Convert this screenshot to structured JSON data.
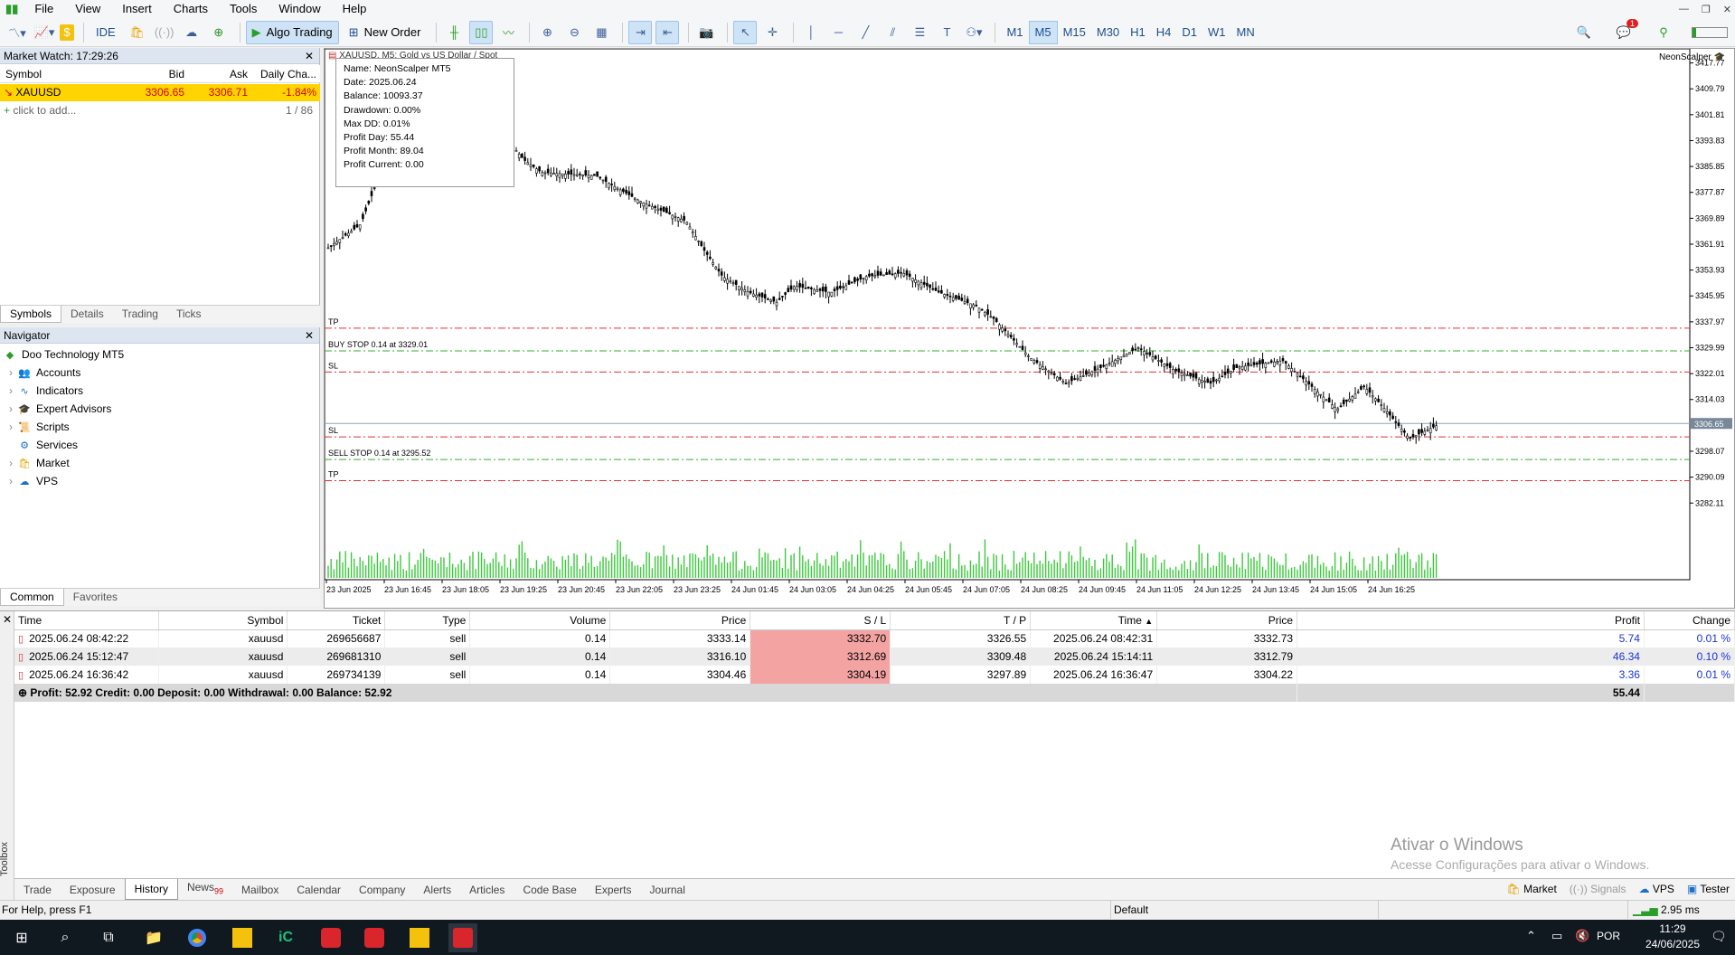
{
  "menu": [
    "File",
    "View",
    "Insert",
    "Charts",
    "Tools",
    "Window",
    "Help"
  ],
  "toolbar": {
    "ide": "IDE",
    "algo": "Algo Trading",
    "new_order": "New Order",
    "timeframes": [
      "M1",
      "M5",
      "M15",
      "M30",
      "H1",
      "H4",
      "D1",
      "W1",
      "MN"
    ],
    "active_tf": "M5",
    "notif_count": "1"
  },
  "market_watch": {
    "title": "Market Watch: 17:29:26",
    "columns": [
      "Symbol",
      "Bid",
      "Ask",
      "Daily Cha..."
    ],
    "rows": [
      {
        "symbol": "XAUUSD",
        "bid": "3306.65",
        "ask": "3306.71",
        "change": "-1.84%"
      }
    ],
    "add": "click to add...",
    "count": "1 / 86",
    "tabs": [
      "Symbols",
      "Details",
      "Trading",
      "Ticks"
    ]
  },
  "navigator": {
    "title": "Navigator",
    "root": "Doo Technology MT5",
    "items": [
      "Accounts",
      "Indicators",
      "Expert Advisors",
      "Scripts",
      "Services",
      "Market",
      "VPS"
    ],
    "tabs": [
      "Common",
      "Favorites"
    ]
  },
  "chart": {
    "title": "XAUUSD, M5: Gold vs US Dollar / Spot",
    "ea_name": "NeonScalper",
    "info": {
      "name": "Name: NeonScalper MT5",
      "date": "Date: 2025.06.24",
      "balance": "Balance: 10093.37",
      "drawdown": "Drawdown: 0.00%",
      "maxdd": "Max DD: 0.01%",
      "pday": "Profit Day: 55.44",
      "pmonth": "Profit Month: 89.04",
      "pcur": "Profit Current: 0.00"
    },
    "price_labels": [
      "3417.77",
      "3409.79",
      "3401.81",
      "3393.83",
      "3385.85",
      "3377.87",
      "3369.89",
      "3361.91",
      "3353.93",
      "3345.95",
      "3337.97",
      "3329.99",
      "3322.01",
      "3314.03",
      "3306.65",
      "3298.07",
      "3290.09",
      "3282.11"
    ],
    "time_labels": [
      "23 Jun 2025",
      "23 Jun 16:45",
      "23 Jun 18:05",
      "23 Jun 19:25",
      "23 Jun 20:45",
      "23 Jun 22:05",
      "23 Jun 23:25",
      "24 Jun 01:45",
      "24 Jun 03:05",
      "24 Jun 04:25",
      "24 Jun 05:45",
      "24 Jun 07:05",
      "24 Jun 08:25",
      "24 Jun 09:45",
      "24 Jun 11:05",
      "24 Jun 12:25",
      "24 Jun 13:45",
      "24 Jun 15:05",
      "24 Jun 16:25"
    ],
    "lines": {
      "tp1": "TP",
      "buy": "BUY STOP 0.14 at 3329.01",
      "sl1": "SL",
      "sl2": "SL",
      "sell": "SELL STOP 0.14 at 3295.52",
      "tp2": "TP"
    },
    "current_price": "3306.65",
    "price_levels": {
      "tp1": 3336.0,
      "buy": 3329.01,
      "sl1": 3322.5,
      "sl2": 3302.5,
      "sell": 3295.52,
      "tp2": 3289.0
    }
  },
  "history": {
    "columns": [
      "Time",
      "Symbol",
      "Ticket",
      "Type",
      "Volume",
      "Price",
      "S / L",
      "T / P",
      "Time",
      "Price",
      "Profit",
      "Change"
    ],
    "rows": [
      [
        "2025.06.24 08:42:22",
        "xauusd",
        "269656687",
        "sell",
        "0.14",
        "3333.14",
        "3332.70",
        "3326.55",
        "2025.06.24 08:42:31",
        "3332.73",
        "5.74",
        "0.01 %"
      ],
      [
        "2025.06.24 15:12:47",
        "xauusd",
        "269681310",
        "sell",
        "0.14",
        "3316.10",
        "3312.69",
        "3309.48",
        "2025.06.24 15:14:11",
        "3312.79",
        "46.34",
        "0.10 %"
      ],
      [
        "2025.06.24 16:36:42",
        "xauusd",
        "269734139",
        "sell",
        "0.14",
        "3304.46",
        "3304.19",
        "3297.89",
        "2025.06.24 16:36:47",
        "3304.22",
        "3.36",
        "0.01 %"
      ]
    ],
    "summary": "Profit: 52.92  Credit: 0.00  Deposit: 0.00  Withdrawal: 0.00  Balance: 52.92",
    "total": "55.44"
  },
  "bottom_tabs": [
    "Trade",
    "Exposure",
    "History",
    "News",
    "Mailbox",
    "Calendar",
    "Company",
    "Alerts",
    "Articles",
    "Code Base",
    "Experts",
    "Journal"
  ],
  "news_count": "99",
  "bottom_right": {
    "market": "Market",
    "signals": "Signals",
    "vps": "VPS",
    "tester": "Tester"
  },
  "toolbox_label": "Toolbox",
  "watermark": {
    "line1": "Ativar o Windows",
    "line2": "Acesse Configurações para ativar o Windows."
  },
  "status": {
    "help": "For Help, press F1",
    "profile": "Default",
    "ping": "2.95 ms"
  },
  "taskbar": {
    "time": "11:29",
    "date": "24/06/2025",
    "lang": "POR"
  },
  "colors": {
    "sl_line": "#e03030",
    "entry_line": "#30b030",
    "volume": "#3cc83c",
    "highlight_row": "#ffd400",
    "sl_cell": "#f4a3a3"
  }
}
